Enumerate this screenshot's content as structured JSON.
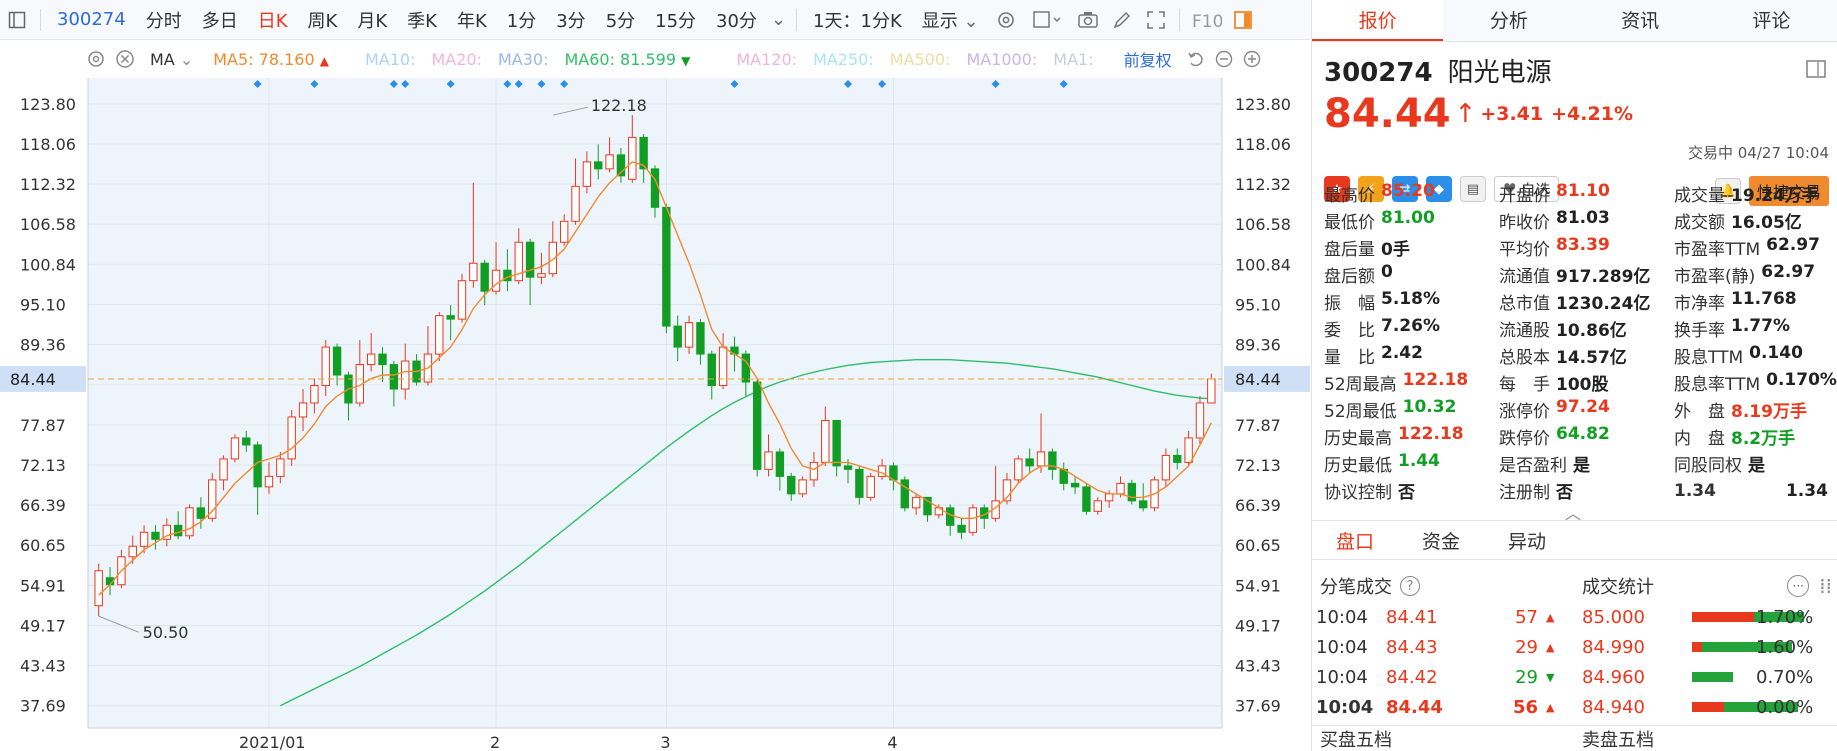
{
  "toolbar": {
    "code": "300274",
    "items": [
      "分时",
      "多日",
      "日K",
      "周K",
      "月K",
      "季K",
      "年K",
      "1分",
      "3分",
      "5分",
      "15分",
      "30分"
    ],
    "active_index": 2,
    "period_select": "1天：1分K",
    "display_label": "显示"
  },
  "indicator": {
    "type": "MA",
    "ma5": "MA5: 78.160",
    "ma10": "MA10:",
    "ma20": "MA20:",
    "ma30": "MA30:",
    "ma60": "MA60: 81.599",
    "ma120": "MA120:",
    "ma250": "MA250:",
    "ma500": "MA500:",
    "ma1000": "MA1000:",
    "ma1": "MA1:",
    "adjust": "前复权"
  },
  "colors": {
    "up": "#e8381d",
    "down": "#129e24",
    "ma5": "#f08a2e",
    "ma60": "#2fbf6b",
    "accent": "#2b6cd8",
    "current_line": "#f0a030"
  },
  "chart_data": {
    "type": "candlestick",
    "y_ticks": [
      "123.80",
      "118.06",
      "112.32",
      "106.58",
      "100.84",
      "95.10",
      "89.36",
      "84.44",
      "77.87",
      "72.13",
      "66.39",
      "60.65",
      "54.91",
      "49.17",
      "43.43",
      "37.69"
    ],
    "y_tick_values": [
      123.8,
      118.06,
      112.32,
      106.58,
      100.84,
      95.1,
      89.36,
      83.62,
      77.87,
      72.13,
      66.39,
      60.65,
      54.91,
      49.17,
      43.43,
      37.69
    ],
    "ylim": [
      34.5,
      127.5
    ],
    "x_labels": [
      {
        "label": "2021/01",
        "index": 15
      },
      {
        "label": "2",
        "index": 35
      },
      {
        "label": "3",
        "index": 50
      },
      {
        "label": "4",
        "index": 70
      }
    ],
    "current_price": 84.44,
    "current_price_label": "84.44",
    "high_annotation": {
      "label": "122.18",
      "index": 40,
      "value": 122.18
    },
    "low_annotation": {
      "label": "50.50",
      "index": 0,
      "value": 50.5
    },
    "marker_indices": [
      14,
      19,
      26,
      27,
      31,
      36,
      37,
      39,
      41,
      56,
      66,
      69,
      79,
      85
    ],
    "candles": [
      [
        52.0,
        57.0,
        58.0,
        50.5
      ],
      [
        56.0,
        55.0,
        57.5,
        53.5
      ],
      [
        55.0,
        59.0,
        60.0,
        54.5
      ],
      [
        59.0,
        60.5,
        62.0,
        58.0
      ],
      [
        60.5,
        62.5,
        63.5,
        59.5
      ],
      [
        62.5,
        61.5,
        63.5,
        60.0
      ],
      [
        61.5,
        63.5,
        64.5,
        60.5
      ],
      [
        63.5,
        62.0,
        65.5,
        61.5
      ],
      [
        62.0,
        66.0,
        66.5,
        61.5
      ],
      [
        66.0,
        64.5,
        67.5,
        63.0
      ],
      [
        64.5,
        70.0,
        71.0,
        64.0
      ],
      [
        70.0,
        73.0,
        73.5,
        68.5
      ],
      [
        73.0,
        76.0,
        76.5,
        72.5
      ],
      [
        76.0,
        75.0,
        77.0,
        74.0
      ],
      [
        75.0,
        69.0,
        75.5,
        65.0
      ],
      [
        69.0,
        70.5,
        72.5,
        68.0
      ],
      [
        70.5,
        73.0,
        74.0,
        69.5
      ],
      [
        73.0,
        79.0,
        80.0,
        72.0
      ],
      [
        79.0,
        81.0,
        83.0,
        77.0
      ],
      [
        81.0,
        83.5,
        84.5,
        79.5
      ],
      [
        83.5,
        89.0,
        90.0,
        82.0
      ],
      [
        89.0,
        85.0,
        89.5,
        83.5
      ],
      [
        85.0,
        81.0,
        85.5,
        78.5
      ],
      [
        81.0,
        86.5,
        90.0,
        80.5
      ],
      [
        86.5,
        88.0,
        91.0,
        85.5
      ],
      [
        88.0,
        86.5,
        89.0,
        84.0
      ],
      [
        86.5,
        83.0,
        87.0,
        80.5
      ],
      [
        83.0,
        87.0,
        89.5,
        81.5
      ],
      [
        87.0,
        84.0,
        88.0,
        83.5
      ],
      [
        84.0,
        88.0,
        92.0,
        83.5
      ],
      [
        88.0,
        93.5,
        94.0,
        87.0
      ],
      [
        93.5,
        93.0,
        95.0,
        90.0
      ],
      [
        93.0,
        98.5,
        99.5,
        92.5
      ],
      [
        98.5,
        101.0,
        112.5,
        97.5
      ],
      [
        101.0,
        97.0,
        101.5,
        95.0
      ],
      [
        97.0,
        100.0,
        104.0,
        96.5
      ],
      [
        100.0,
        98.5,
        103.0,
        97.0
      ],
      [
        98.5,
        104.0,
        106.0,
        98.0
      ],
      [
        104.0,
        99.0,
        104.5,
        95.0
      ],
      [
        99.0,
        99.5,
        102.5,
        98.0
      ],
      [
        99.5,
        104.0,
        107.0,
        99.0
      ],
      [
        104.0,
        107.0,
        108.0,
        103.5
      ],
      [
        107.0,
        112.0,
        116.0,
        106.5
      ],
      [
        112.0,
        115.5,
        117.0,
        111.0
      ],
      [
        115.5,
        114.5,
        118.0,
        113.0
      ],
      [
        114.5,
        116.5,
        119.0,
        114.0
      ],
      [
        116.5,
        113.5,
        117.5,
        112.5
      ],
      [
        113.0,
        119.0,
        122.18,
        112.5
      ],
      [
        119.0,
        114.5,
        119.5,
        112.5
      ],
      [
        114.5,
        109.0,
        115.0,
        107.5
      ],
      [
        109.0,
        92.0,
        109.5,
        91.0
      ],
      [
        92.0,
        89.0,
        93.5,
        87.0
      ],
      [
        89.0,
        92.5,
        93.5,
        88.0
      ],
      [
        92.5,
        88.0,
        93.0,
        86.5
      ],
      [
        88.0,
        83.5,
        88.5,
        81.5
      ],
      [
        83.5,
        89.0,
        91.0,
        83.0
      ],
      [
        89.0,
        88.0,
        90.5,
        85.5
      ],
      [
        88.0,
        84.0,
        88.5,
        82.0
      ],
      [
        84.0,
        71.5,
        84.5,
        70.5
      ],
      [
        71.5,
        74.0,
        76.5,
        70.5
      ],
      [
        74.0,
        70.5,
        74.5,
        68.5
      ],
      [
        70.5,
        68.0,
        71.0,
        67.0
      ],
      [
        68.0,
        70.0,
        70.5,
        67.5
      ],
      [
        70.0,
        72.5,
        74.0,
        69.0
      ],
      [
        72.5,
        78.5,
        80.5,
        72.0
      ],
      [
        78.5,
        72.0,
        78.5,
        70.5
      ],
      [
        72.0,
        71.5,
        73.0,
        69.5
      ],
      [
        71.5,
        67.5,
        72.0,
        66.5
      ],
      [
        67.5,
        70.5,
        71.0,
        67.0
      ],
      [
        70.5,
        72.0,
        73.0,
        70.0
      ],
      [
        72.0,
        70.0,
        72.5,
        68.5
      ],
      [
        70.0,
        66.0,
        70.5,
        65.5
      ],
      [
        66.0,
        67.5,
        68.0,
        65.0
      ],
      [
        67.5,
        65.0,
        67.5,
        64.0
      ],
      [
        65.0,
        66.0,
        66.5,
        64.5
      ],
      [
        66.0,
        63.5,
        66.5,
        62.0
      ],
      [
        63.5,
        62.5,
        64.5,
        61.5
      ],
      [
        62.5,
        66.0,
        66.5,
        62.0
      ],
      [
        66.0,
        64.5,
        66.5,
        63.0
      ],
      [
        64.5,
        67.0,
        72.0,
        64.0
      ],
      [
        67.0,
        70.0,
        71.0,
        66.5
      ],
      [
        70.0,
        73.0,
        73.5,
        69.5
      ],
      [
        73.0,
        72.0,
        74.5,
        71.0
      ],
      [
        72.0,
        74.0,
        79.5,
        71.0
      ],
      [
        74.0,
        71.5,
        74.5,
        70.0
      ],
      [
        71.5,
        69.5,
        72.5,
        68.5
      ],
      [
        69.5,
        69.0,
        70.5,
        68.0
      ],
      [
        69.0,
        65.5,
        69.5,
        65.0
      ],
      [
        65.5,
        67.0,
        67.5,
        65.0
      ],
      [
        67.0,
        68.0,
        68.5,
        66.0
      ],
      [
        68.0,
        69.5,
        70.5,
        67.5
      ],
      [
        69.5,
        67.0,
        70.0,
        66.5
      ],
      [
        67.0,
        66.0,
        69.5,
        65.5
      ],
      [
        66.0,
        70.0,
        70.5,
        65.5
      ],
      [
        70.0,
        73.5,
        74.5,
        69.0
      ],
      [
        73.5,
        72.5,
        74.5,
        71.5
      ],
      [
        72.5,
        76.0,
        77.0,
        72.0
      ],
      [
        76.0,
        81.0,
        82.0,
        75.0
      ],
      [
        81.0,
        84.44,
        85.2,
        81.0
      ]
    ],
    "ma5": [
      53.5,
      55.0,
      57.0,
      58.5,
      60.0,
      61.0,
      62.0,
      62.5,
      63.0,
      64.0,
      65.5,
      67.5,
      69.5,
      71.0,
      72.5,
      73.0,
      73.5,
      74.5,
      76.0,
      78.0,
      80.5,
      82.0,
      83.0,
      83.5,
      84.5,
      85.0,
      85.0,
      85.5,
      85.5,
      86.0,
      87.5,
      89.0,
      91.5,
      94.5,
      96.5,
      98.0,
      99.0,
      99.5,
      100.0,
      100.5,
      101.5,
      103.0,
      105.5,
      108.0,
      110.5,
      112.5,
      114.0,
      115.5,
      115.0,
      113.0,
      109.0,
      105.0,
      101.0,
      96.5,
      91.5,
      89.0,
      88.0,
      87.0,
      84.5,
      81.0,
      78.0,
      74.5,
      72.0,
      71.5,
      72.5,
      72.5,
      72.5,
      72.0,
      71.5,
      71.0,
      70.0,
      69.0,
      68.0,
      67.0,
      66.0,
      65.0,
      64.5,
      64.5,
      65.0,
      66.0,
      67.5,
      69.5,
      71.0,
      72.0,
      72.0,
      71.5,
      70.5,
      69.5,
      68.5,
      68.0,
      68.0,
      67.5,
      67.5,
      68.0,
      69.0,
      70.5,
      72.0,
      75.0,
      78.16
    ],
    "ma60": [
      37.69,
      38.5,
      39.3,
      40.1,
      40.9,
      41.7,
      42.5,
      43.3,
      44.2,
      45.1,
      46.0,
      46.9,
      47.8,
      48.8,
      49.8,
      50.8,
      51.9,
      53.0,
      54.1,
      55.3,
      56.5,
      57.7,
      59.0,
      60.3,
      61.6,
      62.9,
      64.2,
      65.5,
      66.8,
      68.1,
      69.4,
      70.7,
      72.0,
      73.3,
      74.6,
      75.8,
      77.0,
      78.1,
      79.2,
      80.2,
      81.1,
      81.9,
      82.7,
      83.4,
      84.0,
      84.5,
      85.0,
      85.4,
      85.8,
      86.1,
      86.4,
      86.6,
      86.8,
      86.9,
      87.0,
      87.1,
      87.2,
      87.2,
      87.2,
      87.2,
      87.1,
      87.0,
      86.9,
      86.8,
      86.7,
      86.5,
      86.3,
      86.1,
      85.9,
      85.6,
      85.3,
      85.0,
      84.7,
      84.3,
      83.9,
      83.5,
      83.1,
      82.7,
      82.4,
      82.1,
      81.9,
      81.7,
      81.6
    ]
  },
  "right": {
    "tabs": [
      "报价",
      "分析",
      "资讯",
      "评论"
    ],
    "active_tab": 0,
    "code": "300274",
    "name": "阳光电源",
    "price": "84.44",
    "change": "+3.41",
    "pct": "+4.21%",
    "status": "交易中 04/27 10:04",
    "watch_label": "自选",
    "quick_trade": "快捷交易",
    "quote_rows": [
      [
        {
          "l": "最高价",
          "v": "85.20",
          "c": "up"
        },
        {
          "l": "开盘价",
          "v": "81.10",
          "c": "up"
        },
        {
          "l": "成交量",
          "v": "19.24万手",
          "c": ""
        }
      ],
      [
        {
          "l": "最低价",
          "v": "81.00",
          "c": "down"
        },
        {
          "l": "昨收价",
          "v": "81.03",
          "c": ""
        },
        {
          "l": "成交额",
          "v": "16.05亿",
          "c": ""
        }
      ],
      [
        {
          "l": "盘后量",
          "v": "0手",
          "c": ""
        },
        {
          "l": "平均价",
          "v": "83.39",
          "c": "up"
        },
        {
          "l": "市盈率TTM",
          "v": "62.97",
          "c": ""
        }
      ],
      [
        {
          "l": "盘后额",
          "v": "0",
          "c": ""
        },
        {
          "l": "流通值",
          "v": "917.289亿",
          "c": ""
        },
        {
          "l": "市盈率(静)",
          "v": "62.97",
          "c": ""
        }
      ],
      [
        {
          "l": "振　幅",
          "v": "5.18%",
          "c": ""
        },
        {
          "l": "总市值",
          "v": "1230.24亿",
          "c": ""
        },
        {
          "l": "市净率",
          "v": "11.768",
          "c": ""
        }
      ],
      [
        {
          "l": "委　比",
          "v": "7.26%",
          "c": ""
        },
        {
          "l": "流通股",
          "v": "10.86亿",
          "c": ""
        },
        {
          "l": "换手率",
          "v": "1.77%",
          "c": ""
        }
      ],
      [
        {
          "l": "量　比",
          "v": "2.42",
          "c": ""
        },
        {
          "l": "总股本",
          "v": "14.57亿",
          "c": ""
        },
        {
          "l": "股息TTM",
          "v": "0.140",
          "c": ""
        }
      ],
      [
        {
          "l": "52周最高",
          "v": "122.18",
          "c": "up"
        },
        {
          "l": "每　手",
          "v": "100股",
          "c": ""
        },
        {
          "l": "股息率TTM",
          "v": "0.170%",
          "c": ""
        }
      ],
      [
        {
          "l": "52周最低",
          "v": "10.32",
          "c": "down"
        },
        {
          "l": "涨停价",
          "v": "97.24",
          "c": "up"
        },
        {
          "l": "外　盘",
          "v": "8.19万手",
          "c": "up"
        }
      ],
      [
        {
          "l": "历史最高",
          "v": "122.18",
          "c": "up"
        },
        {
          "l": "跌停价",
          "v": "64.82",
          "c": "down"
        },
        {
          "l": "内　盘",
          "v": "8.2万手",
          "c": "down"
        }
      ],
      [
        {
          "l": "历史最低",
          "v": "1.44",
          "c": "down"
        },
        {
          "l": "是否盈利",
          "v": "是",
          "c": ""
        },
        {
          "l": "同股同权",
          "v": "是",
          "c": ""
        }
      ],
      [
        {
          "l": "协议控制",
          "v": "否",
          "c": ""
        },
        {
          "l": "注册制",
          "v": "否",
          "c": ""
        },
        {
          "l": "1.34",
          "v": "1.34",
          "c": ""
        }
      ]
    ],
    "pk_tabs": [
      "盘口",
      "资金",
      "异动"
    ],
    "ticks_title": "分笔成交",
    "ticks": [
      {
        "t": "10:04",
        "p": "84.41",
        "v": "57",
        "dir": "up"
      },
      {
        "t": "10:04",
        "p": "84.43",
        "v": "29",
        "dir": "up"
      },
      {
        "t": "10:04",
        "p": "84.42",
        "v": "29",
        "dir": "down"
      },
      {
        "t": "10:04",
        "p": "84.44",
        "v": "56",
        "dir": "up"
      }
    ],
    "stats_title": "成交统计",
    "stats": [
      {
        "p": "85.000",
        "pct": "1.70%",
        "fill": 0.95,
        "red": 0.55
      },
      {
        "p": "84.990",
        "pct": "1.60%",
        "fill": 0.85,
        "red": 0.1
      },
      {
        "p": "84.960",
        "pct": "0.70%",
        "fill": 0.35,
        "red": 0.0
      },
      {
        "p": "84.940",
        "pct": "0.00%",
        "fill": 0.9,
        "red": 0.3
      }
    ],
    "buy5": "买盘五档",
    "sell5": "卖盘五档"
  }
}
